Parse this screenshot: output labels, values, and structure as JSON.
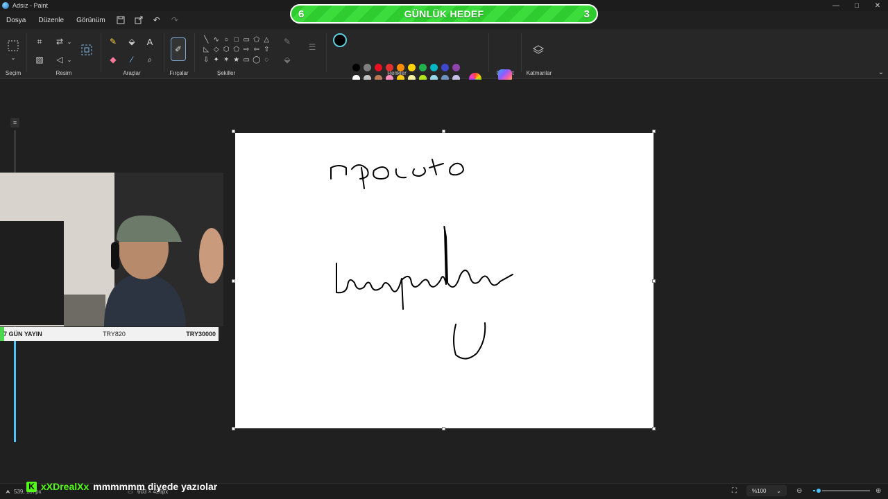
{
  "window": {
    "title": "Adsız - Paint",
    "minimize": "—",
    "maximize": "□",
    "close": "✕"
  },
  "goal": {
    "left_count": "6",
    "title": "GÜNLÜK HEDEF",
    "right_count": "3"
  },
  "menu": {
    "file": "Dosya",
    "edit": "Düzenle",
    "view": "Görünüm"
  },
  "ribbon": {
    "selection": "Seçim",
    "image": "Resim",
    "tools": "Araçlar",
    "brushes": "Fırçalar",
    "shapes": "Şekiller",
    "colors": "Renkler",
    "copilot": "Copilot",
    "layers": "Katmanlar"
  },
  "shapes": [
    "╲",
    "∿",
    "○",
    "□",
    "▭",
    "⬠",
    "△",
    "◺",
    "◇",
    "⬡",
    "⬠",
    "⇨",
    "⇦",
    "⇧",
    "⇩",
    "✦",
    "✶",
    "★",
    "▭",
    "◯",
    "◌"
  ],
  "palette_row1": [
    "#000000",
    "#7f7f7f",
    "#e81123",
    "#e03030",
    "#ff8c00",
    "#ffd400",
    "#22b14c",
    "#00b7c3",
    "#3f48cc",
    "#8e44ad"
  ],
  "palette_row2": [
    "#ffffff",
    "#c3c3c3",
    "#b97a57",
    "#ff8fbf",
    "#ffc90e",
    "#f7f2a0",
    "#b5e61d",
    "#99d9ea",
    "#7092be",
    "#c8bfe7"
  ],
  "stream_bar": {
    "label": "7 GÜN YAYIN",
    "mid": "TRY820",
    "right": "TRY30000"
  },
  "canvas_text": {
    "line1": "npocto",
    "line2": "Leeqeelae",
    "line3": "U"
  },
  "status": {
    "pointer": "539, 187px",
    "canvas_size": "603 × 426px",
    "zoom": "%100"
  },
  "chat": {
    "platform": "K",
    "user": "xXDrealXx",
    "message": "mmmmmm diyede yazıolar"
  }
}
